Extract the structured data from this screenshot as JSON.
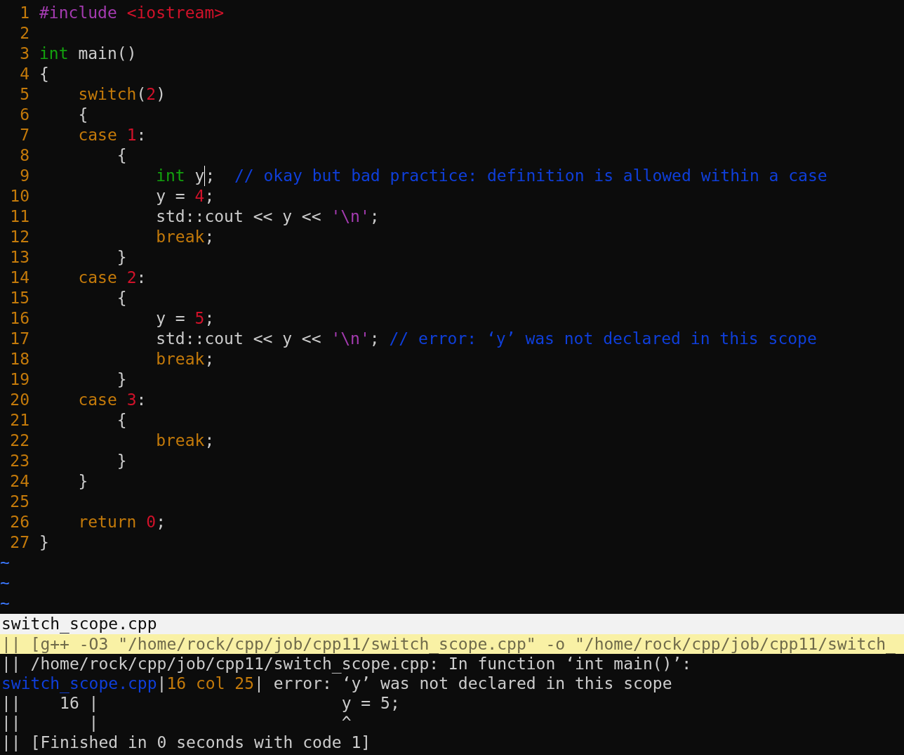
{
  "editor": {
    "lines": [
      {
        "number": "1",
        "tokens": [
          {
            "kind": "preproc",
            "text": "#include"
          },
          {
            "kind": "string",
            "text": " <iostream>"
          }
        ]
      },
      {
        "number": "2"
      },
      {
        "number": "3",
        "tokens": [
          {
            "kind": "type",
            "text": "int"
          },
          {
            "kind": "plain",
            "text": " main()"
          }
        ]
      },
      {
        "number": "4",
        "tokens": [
          {
            "kind": "plain",
            "text": "{"
          }
        ]
      },
      {
        "number": "5",
        "tokens": [
          {
            "kind": "keyword",
            "text": "    switch"
          },
          {
            "kind": "plain",
            "text": "("
          },
          {
            "kind": "number",
            "text": "2"
          },
          {
            "kind": "plain",
            "text": ")"
          }
        ]
      },
      {
        "number": "6",
        "tokens": [
          {
            "kind": "plain",
            "text": "    {"
          }
        ]
      },
      {
        "number": "7",
        "tokens": [
          {
            "kind": "keyword",
            "text": "    case"
          },
          {
            "kind": "number",
            "text": " 1"
          },
          {
            "kind": "plain",
            "text": ":"
          }
        ]
      },
      {
        "number": "8",
        "tokens": [
          {
            "kind": "plain",
            "text": "        {"
          }
        ]
      },
      {
        "number": "9",
        "tokens": [
          {
            "kind": "type",
            "text": "            int"
          },
          {
            "kind": "cursor",
            "text": " y"
          },
          {
            "kind": "plain",
            "text": ";"
          },
          {
            "kind": "comment",
            "text": "  // okay but bad practice: definition is allowed within a case"
          }
        ]
      },
      {
        "number": "10",
        "tokens": [
          {
            "kind": "plain",
            "text": "            y = "
          },
          {
            "kind": "number",
            "text": "4"
          },
          {
            "kind": "plain",
            "text": ";"
          }
        ]
      },
      {
        "number": "11",
        "tokens": [
          {
            "kind": "plain",
            "text": "            std::cout << y << "
          },
          {
            "kind": "char",
            "text": "'\\n'"
          },
          {
            "kind": "plain",
            "text": ";"
          }
        ]
      },
      {
        "number": "12",
        "tokens": [
          {
            "kind": "keyword",
            "text": "            break"
          },
          {
            "kind": "plain",
            "text": ";"
          }
        ]
      },
      {
        "number": "13",
        "tokens": [
          {
            "kind": "plain",
            "text": "        }"
          }
        ]
      },
      {
        "number": "14",
        "tokens": [
          {
            "kind": "keyword",
            "text": "    case"
          },
          {
            "kind": "number",
            "text": " 2"
          },
          {
            "kind": "plain",
            "text": ":"
          }
        ]
      },
      {
        "number": "15",
        "tokens": [
          {
            "kind": "plain",
            "text": "        {"
          }
        ]
      },
      {
        "number": "16",
        "tokens": [
          {
            "kind": "plain",
            "text": "            y = "
          },
          {
            "kind": "number",
            "text": "5"
          },
          {
            "kind": "plain",
            "text": ";"
          }
        ]
      },
      {
        "number": "17",
        "tokens": [
          {
            "kind": "plain",
            "text": "            std::cout << y << "
          },
          {
            "kind": "char",
            "text": "'\\n'"
          },
          {
            "kind": "plain",
            "text": ";"
          },
          {
            "kind": "comment",
            "text": " // error: ‘y’ was not declared in this scope"
          }
        ]
      },
      {
        "number": "18",
        "tokens": [
          {
            "kind": "keyword",
            "text": "            break"
          },
          {
            "kind": "plain",
            "text": ";"
          }
        ]
      },
      {
        "number": "19",
        "tokens": [
          {
            "kind": "plain",
            "text": "        }"
          }
        ]
      },
      {
        "number": "20",
        "tokens": [
          {
            "kind": "keyword",
            "text": "    case"
          },
          {
            "kind": "number",
            "text": " 3"
          },
          {
            "kind": "plain",
            "text": ":"
          }
        ]
      },
      {
        "number": "21",
        "tokens": [
          {
            "kind": "plain",
            "text": "        {"
          }
        ]
      },
      {
        "number": "22",
        "tokens": [
          {
            "kind": "keyword",
            "text": "            break"
          },
          {
            "kind": "plain",
            "text": ";"
          }
        ]
      },
      {
        "number": "23",
        "tokens": [
          {
            "kind": "plain",
            "text": "        }"
          }
        ]
      },
      {
        "number": "24",
        "tokens": [
          {
            "kind": "plain",
            "text": "    }"
          }
        ]
      },
      {
        "number": "25"
      },
      {
        "number": "26",
        "tokens": [
          {
            "kind": "keyword",
            "text": "    return"
          },
          {
            "kind": "number",
            "text": " 0"
          },
          {
            "kind": "plain",
            "text": ";"
          }
        ]
      },
      {
        "number": "27",
        "tokens": [
          {
            "kind": "plain",
            "text": "}"
          }
        ]
      }
    ],
    "filler": [
      "~",
      "~",
      "~"
    ]
  },
  "status_line": {
    "filename": "switch_scope.cpp"
  },
  "quickfix": {
    "rows": [
      {
        "selected": true,
        "tokens": [
          {
            "kind": "plain",
            "text": "|| [g++ -O3 \"/home/rock/cpp/job/cpp11/switch_scope.cpp\" -o \"/home/rock/cpp/job/cpp11/switch_"
          }
        ]
      },
      {
        "selected": false,
        "tokens": [
          {
            "kind": "plain",
            "text": "|| /home/rock/cpp/job/cpp11/switch_scope.cpp: In function ‘int main()’:"
          }
        ]
      },
      {
        "selected": false,
        "tokens": [
          {
            "kind": "file",
            "text": "switch_scope.cpp"
          },
          {
            "kind": "plain",
            "text": "|"
          },
          {
            "kind": "position",
            "text": "16 col 25"
          },
          {
            "kind": "plain",
            "text": "| error: ‘y’ was not declared in this scope"
          }
        ]
      },
      {
        "selected": false,
        "tokens": [
          {
            "kind": "plain",
            "text": "||    16 |                         y = 5;"
          }
        ]
      },
      {
        "selected": false,
        "tokens": [
          {
            "kind": "plain",
            "text": "||       |                         ^"
          }
        ]
      },
      {
        "selected": false,
        "tokens": [
          {
            "kind": "plain",
            "text": "|| [Finished in 0 seconds with code 1]"
          }
        ]
      }
    ]
  }
}
